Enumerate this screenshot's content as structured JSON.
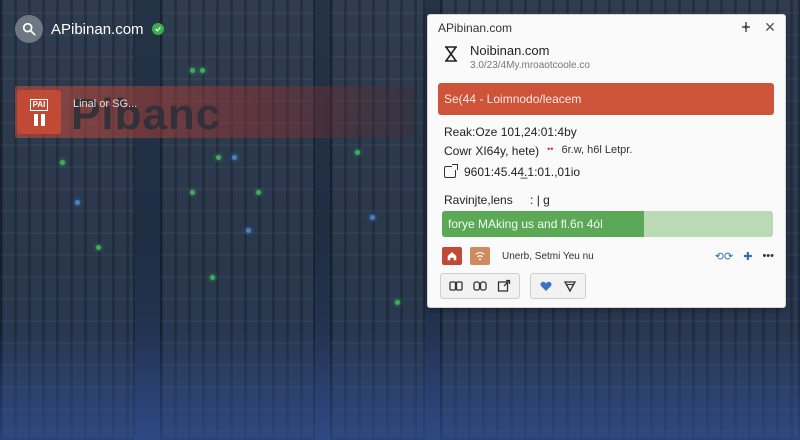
{
  "address_bar": {
    "host": "APibinan.com"
  },
  "banner": {
    "logo_label": "PAI",
    "small_text": "Linal or SG...",
    "brand": "Pibanc"
  },
  "panel": {
    "title": "APibinan.com",
    "site_name": "Noibinan.com",
    "site_sub": "3.0/23/4My.mroaotcoole.co",
    "red_bar_text": "Se(44 - Loimnodo/leacem",
    "row1": "Reak:Oze 101,24:01:4by",
    "row2_left": "Cowr XI64y, hete)",
    "row2_dots": "••",
    "row2_right": "6r.w, h6l Letpr.",
    "row3": "9601:45.44̲.1:01.,01io",
    "row4": "Ravinjte,lens",
    "row4_suffix": ": | g",
    "green_bar_text": "forye MAking us and fl.6n 4ól",
    "green_bar_progress": 0.61,
    "meta_text": "Unerb, Setmi Yeu nu",
    "colors": {
      "red_bar": "#cd5339",
      "green_fill": "#5ba857",
      "green_track": "#b9dab4",
      "link_blue": "#2b6fb8"
    },
    "toolbar_icons": [
      "book-icon",
      "book-open-icon",
      "external-link-icon",
      "heart-icon",
      "shield-icon"
    ]
  }
}
